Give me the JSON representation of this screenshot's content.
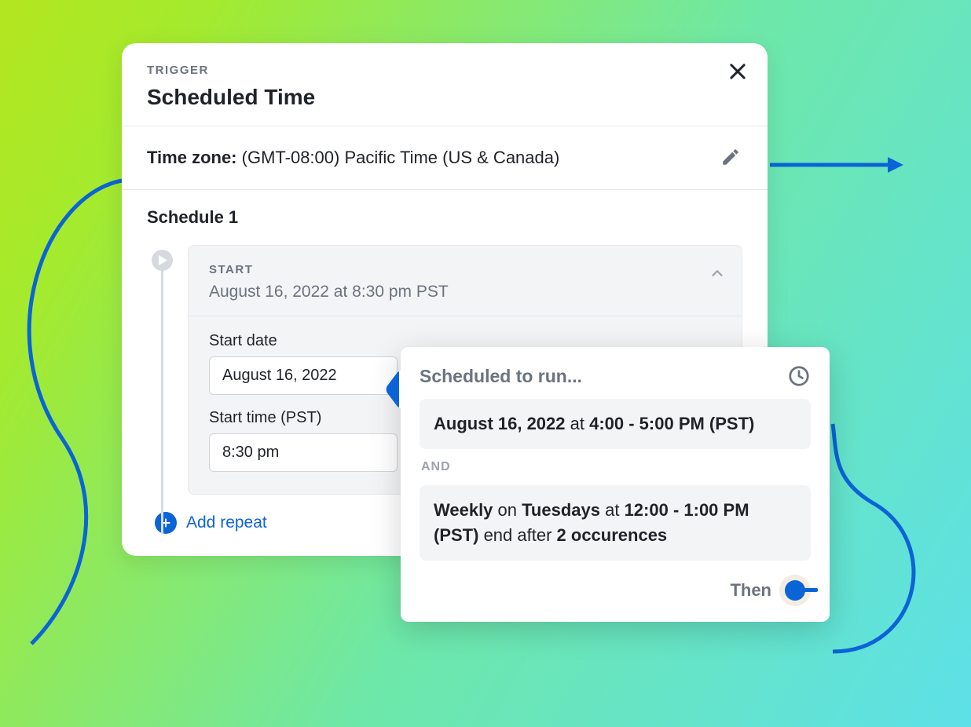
{
  "trigger": {
    "eyebrow": "TRIGGER",
    "title": "Scheduled Time",
    "timezone_label": "Time zone:",
    "timezone_value": "(GMT-08:00) Pacific Time (US & Canada)"
  },
  "schedule": {
    "heading": "Schedule 1",
    "start_label": "START",
    "start_datetime": "August 16, 2022 at 8:30 pm PST",
    "start_date_label": "Start date",
    "start_date_value": "August 16, 2022",
    "start_time_label": "Start time (PST)",
    "start_time_value": "8:30 pm",
    "add_repeat": "Add repeat"
  },
  "popover": {
    "title": "Scheduled to run...",
    "rule1_date": "August 16, 2022",
    "rule1_at": " at ",
    "rule1_time": "4:00 - 5:00 PM (PST)",
    "and_label": "AND",
    "rule2_freq": "Weekly",
    "rule2_on": " on ",
    "rule2_day": "Tuesdays",
    "rule2_at": " at ",
    "rule2_time": "12:00 - 1:00 PM (PST)",
    "rule2_end": " end after ",
    "rule2_occurrences": "2 occurences",
    "then_label": "Then"
  }
}
